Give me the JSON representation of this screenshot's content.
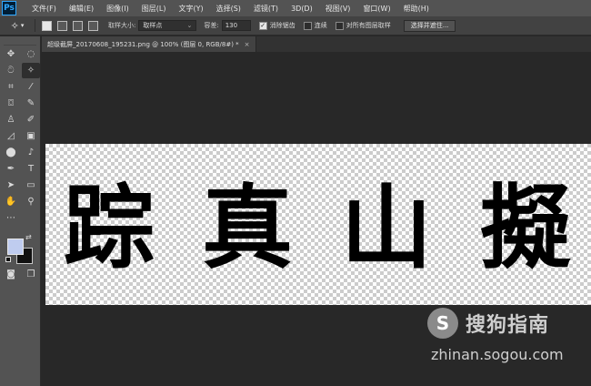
{
  "app": {
    "logo": "Ps"
  },
  "menu": [
    "文件(F)",
    "编辑(E)",
    "图像(I)",
    "图层(L)",
    "文字(Y)",
    "选择(S)",
    "滤镜(T)",
    "3D(D)",
    "视图(V)",
    "窗口(W)",
    "帮助(H)"
  ],
  "options": {
    "tool_icon": "magic-wand-icon",
    "sample_size_label": "取样大小:",
    "sample_size_value": "取样点",
    "tolerance_label": "容差:",
    "tolerance_value": "130",
    "anti_alias_label": "消除锯齿",
    "anti_alias_checked": true,
    "contiguous_label": "连续",
    "contiguous_checked": false,
    "all_layers_label": "对所有图层取样",
    "all_layers_checked": false,
    "select_subject_label": "选择并遮住..."
  },
  "document": {
    "tab_title": "超级截屏_20170608_195231.png @ 100% (图层 0, RGB/8#) *",
    "close_glyph": "×",
    "characters": [
      "踪",
      "真",
      "山",
      "擬"
    ]
  },
  "tools": [
    [
      "move-icon",
      "marquee-icon"
    ],
    [
      "lasso-icon",
      "magic-wand-icon"
    ],
    [
      "crop-icon",
      "eyedropper-icon"
    ],
    [
      "healing-brush-icon",
      "brush-icon"
    ],
    [
      "clone-stamp-icon",
      "history-brush-icon"
    ],
    [
      "eraser-icon",
      "gradient-icon"
    ],
    [
      "blur-icon",
      "dodge-icon"
    ],
    [
      "pen-icon",
      "type-icon"
    ],
    [
      "path-selection-icon",
      "rectangle-icon"
    ],
    [
      "hand-icon",
      "zoom-icon"
    ]
  ],
  "colors": {
    "foreground": "#bfccef",
    "background": "#111111",
    "ui_dark": "#282828",
    "ui_panel": "#535353"
  },
  "watermark": {
    "logo_glyph": "S",
    "name": "搜狗指南",
    "url": "zhinan.sogou.com"
  }
}
